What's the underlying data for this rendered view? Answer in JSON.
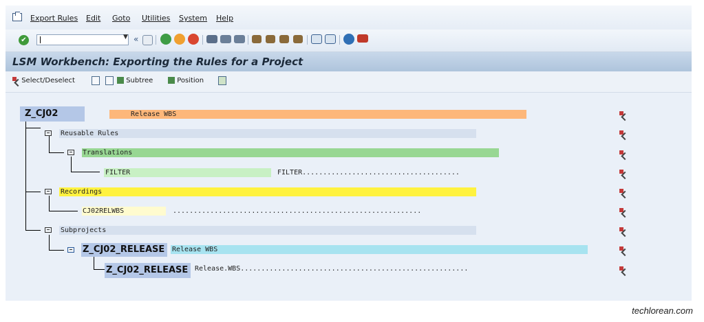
{
  "menu": {
    "items": [
      "Export Rules",
      "Edit",
      "Goto",
      "Utilities",
      "System",
      "Help"
    ]
  },
  "toolbar": {
    "command_value": "",
    "icons": [
      "check-icon",
      "back-icon",
      "save-icon",
      "back-green-icon",
      "exit-icon",
      "cancel-icon",
      "print-icon",
      "find-icon",
      "find-next-icon",
      "first-page-icon",
      "prev-page-icon",
      "next-page-icon",
      "last-page-icon",
      "new-session-icon",
      "shortcut-icon",
      "help-icon",
      "customize-icon"
    ]
  },
  "title": "LSM Workbench: Exporting the Rules for a Project",
  "app_toolbar": {
    "select_deselect": "Select/Deselect",
    "subtree": "Subtree",
    "position": "Position"
  },
  "tree": {
    "root": {
      "name": "Z_CJ02",
      "desc": "Release WBS"
    },
    "reusable": {
      "label": "Reusable Rules"
    },
    "translations": {
      "label": "Translations"
    },
    "filter": {
      "label": "FILTER",
      "value": "FILTER......................................"
    },
    "recordings": {
      "label": "Recordings"
    },
    "recording_item": {
      "label": "CJ02RELWBS",
      "dots": "............................................................"
    },
    "subprojects": {
      "label": "Subprojects"
    },
    "subproject": {
      "name": "Z_CJ02_RELEASE",
      "desc": "Release WBS"
    },
    "subproject_child": {
      "name": "Z_CJ02_RELEASE",
      "desc": "Release.WBS......................................................."
    }
  },
  "colors": {
    "orange": "#fdb77a",
    "lightblue": "#d6e0ee",
    "green": "#98d793",
    "lightgreen": "#c8f0c4",
    "yellow": "#fff23f",
    "paleyellow": "#fffbcf",
    "cyan": "#a7e3f0",
    "nodeblue": "#b4c7e7"
  },
  "watermark": "techlorean.com"
}
